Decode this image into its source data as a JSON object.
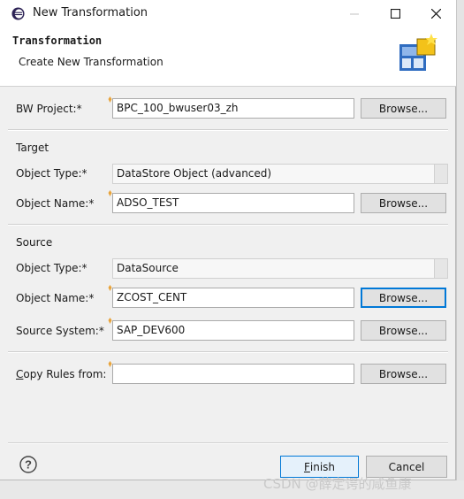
{
  "window": {
    "title": "New Transformation",
    "minimize_icon": "minimize-icon",
    "maximize_icon": "maximize-icon",
    "close_icon": "close-icon"
  },
  "header": {
    "title": "Transformation",
    "subtitle": "Create New Transformation"
  },
  "bw_project": {
    "label": "BW Project:*",
    "value": "BPC_100_bwuser03_zh",
    "browse": "Browse..."
  },
  "target": {
    "group": "Target",
    "object_type_label": "Object Type:*",
    "object_type_value": "DataStore Object (advanced)",
    "object_name_label": "Object Name:*",
    "object_name_value": "ADSO_TEST",
    "browse": "Browse..."
  },
  "source": {
    "group": "Source",
    "object_type_label": "Object Type:*",
    "object_type_value": "DataSource",
    "object_name_label": "Object Name:*",
    "object_name_value": "ZCOST_CENT",
    "object_name_browse": "Browse...",
    "source_system_label": "Source System:*",
    "source_system_value": "SAP_DEV600",
    "source_system_browse": "Browse..."
  },
  "copy_rules": {
    "label_first": "C",
    "label_rest": "opy Rules from:",
    "value": "",
    "browse": "Browse..."
  },
  "footer": {
    "help_icon": "help-icon",
    "finish_first": "F",
    "finish_rest": "inish",
    "cancel": "Cancel"
  },
  "watermark": "CSDN @薛定谔的咸鱼康"
}
